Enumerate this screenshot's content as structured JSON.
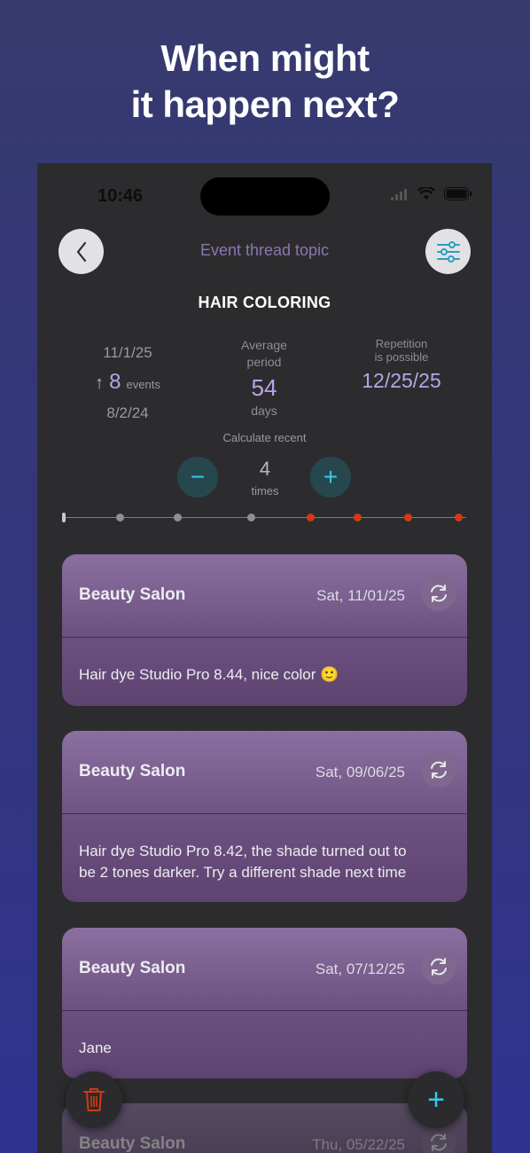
{
  "headline": {
    "line1": "When might",
    "line2": "it happen next?"
  },
  "status": {
    "time": "10:46"
  },
  "header": {
    "topic_label": "Event thread topic",
    "title": "HAIR COLORING"
  },
  "stats": {
    "last_date": "11/1/25",
    "count": "8",
    "count_unit": "events",
    "first_date": "8/2/24",
    "avg_label_1": "Average",
    "avg_label_2": "period",
    "avg_value": "54",
    "avg_unit": "days",
    "repeat_label_1": "Repetition",
    "repeat_label_2": "is possible",
    "repeat_date": "12/25/25"
  },
  "recent": {
    "label": "Calculate recent",
    "value": "4",
    "unit": "times",
    "minus": "−",
    "plus": "+"
  },
  "timeline": {
    "dot_colors": [
      "gray",
      "gray",
      "gray",
      "red",
      "red",
      "red",
      "red"
    ],
    "gray_color": "#8e8e93",
    "red_color": "#d23a12"
  },
  "events": [
    {
      "place": "Beauty Salon",
      "date": "Sat, 11/01/25",
      "note_line1": "Hair dye Studio Pro 8.44, nice color 🙂",
      "note_line2": ""
    },
    {
      "place": "Beauty Salon",
      "date": "Sat, 09/06/25",
      "note_line1": "Hair dye Studio Pro 8.42, the shade turned out to",
      "note_line2": "be 2 tones darker. Try a different shade next time"
    },
    {
      "place": "Beauty Salon",
      "date": "Sat, 07/12/25",
      "note_line1": "Jane",
      "note_line2": ""
    },
    {
      "place": "Beauty Salon",
      "date": "Thu, 05/22/25",
      "note_line1": "",
      "note_line2": ""
    }
  ],
  "actions": {
    "add": "+"
  },
  "icons": {
    "back": "chevron-left-icon",
    "filter": "sliders-icon",
    "sync": "sync-icon",
    "trash": "trash-icon",
    "add": "plus-icon"
  },
  "colors": {
    "accent": "#37c8e8",
    "value_purple": "#b8a4ea",
    "danger": "#d23a12"
  }
}
